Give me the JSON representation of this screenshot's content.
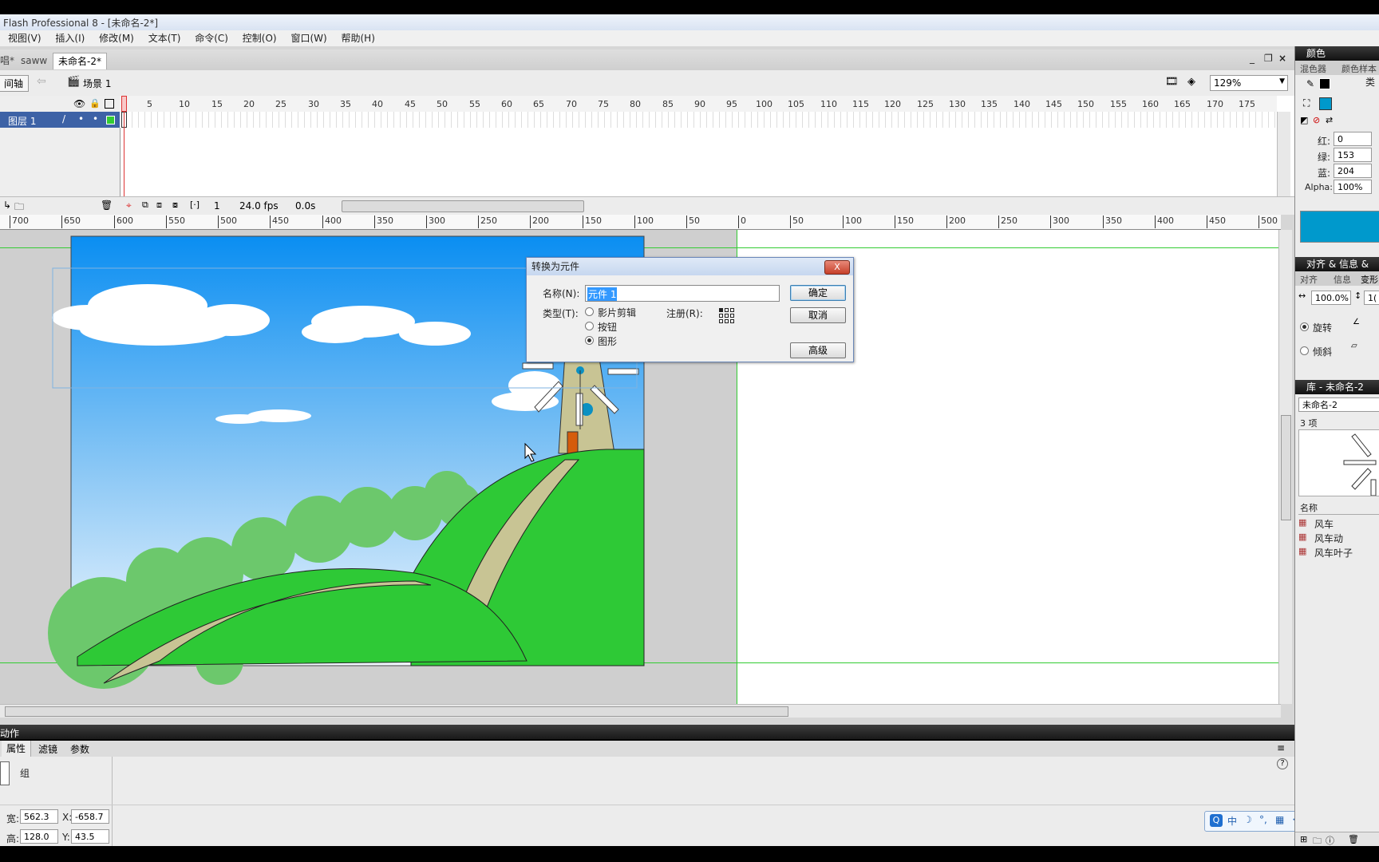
{
  "window": {
    "title": "Flash Professional 8 - [未命名-2*]"
  },
  "menu": [
    "视图(V)",
    "插入(I)",
    "修改(M)",
    "文本(T)",
    "命令(C)",
    "控制(O)",
    "窗口(W)",
    "帮助(H)"
  ],
  "tabs": {
    "t0": "唱*",
    "t1": "saww",
    "t2": "未命名-2*"
  },
  "window_controls": {
    "minimize": "_",
    "restore": "❐",
    "close": "×"
  },
  "edit_bar": {
    "timeline_toggle": "间轴",
    "scene": "场景 1",
    "zoom": "129%"
  },
  "timeline": {
    "frame_ticks": [
      "5",
      "10",
      "15",
      "20",
      "25",
      "30",
      "35",
      "40",
      "45",
      "50",
      "55",
      "60",
      "65",
      "70",
      "75",
      "80",
      "85",
      "90",
      "95",
      "100",
      "105",
      "110",
      "115",
      "120",
      "125",
      "130",
      "135",
      "140",
      "145",
      "150",
      "155",
      "160",
      "165",
      "170",
      "175"
    ],
    "layer_name": "图层 1",
    "current_frame": "1",
    "fps": "24.0 fps",
    "elapsed": "0.0s"
  },
  "stage_ruler": [
    "700",
    "650",
    "600",
    "550",
    "500",
    "450",
    "400",
    "350",
    "300",
    "250",
    "200",
    "150",
    "100",
    "50",
    "0",
    "50",
    "100",
    "150",
    "200",
    "250",
    "300",
    "350",
    "400",
    "450",
    "500"
  ],
  "dialog": {
    "title": "转换为元件",
    "name_label": "名称(N):",
    "name_value": "元件 1",
    "type_label": "类型(T):",
    "type_options": [
      "影片剪辑",
      "按钮",
      "图形"
    ],
    "type_selected": "图形",
    "registration_label": "注册(R):",
    "ok": "确定",
    "cancel": "取消",
    "advanced": "高级",
    "close": "X"
  },
  "actions_bar": {
    "label": "动作"
  },
  "properties": {
    "tabs": [
      "属性",
      "滤镜",
      "参数"
    ],
    "kind": "组",
    "width_label": "宽:",
    "width": "562.3",
    "height_label": "高:",
    "height": "128.0",
    "x_label": "X:",
    "x": "-658.7",
    "y_label": "Y:",
    "y": "43.5",
    "help": "?"
  },
  "color_panel": {
    "header": "颜色",
    "tabs": [
      "混色器",
      "颜色样本"
    ],
    "type_label": "类",
    "red_label": "红:",
    "red": "0",
    "green_label": "绿:",
    "green": "153",
    "blue_label": "蓝:",
    "blue": "204",
    "alpha_label": "Alpha:",
    "alpha": "100%",
    "swatch_color": "#0099cc"
  },
  "align_panel": {
    "header": "对齐 & 信息 &",
    "tabs": [
      "对齐",
      "信息",
      "变形"
    ],
    "scale": "100.0%",
    "scale2": "1(",
    "rotate": "旋转",
    "skew": "倾斜"
  },
  "library_panel": {
    "header": "库 - 未命名-2",
    "doc": "未命名-2",
    "count": "3 项",
    "column": "名称",
    "items": [
      "风车",
      "风车动",
      "风车叶子"
    ]
  },
  "ime": {
    "items": [
      "中",
      "☽",
      "°,",
      "▦",
      "✢",
      "✎"
    ]
  }
}
